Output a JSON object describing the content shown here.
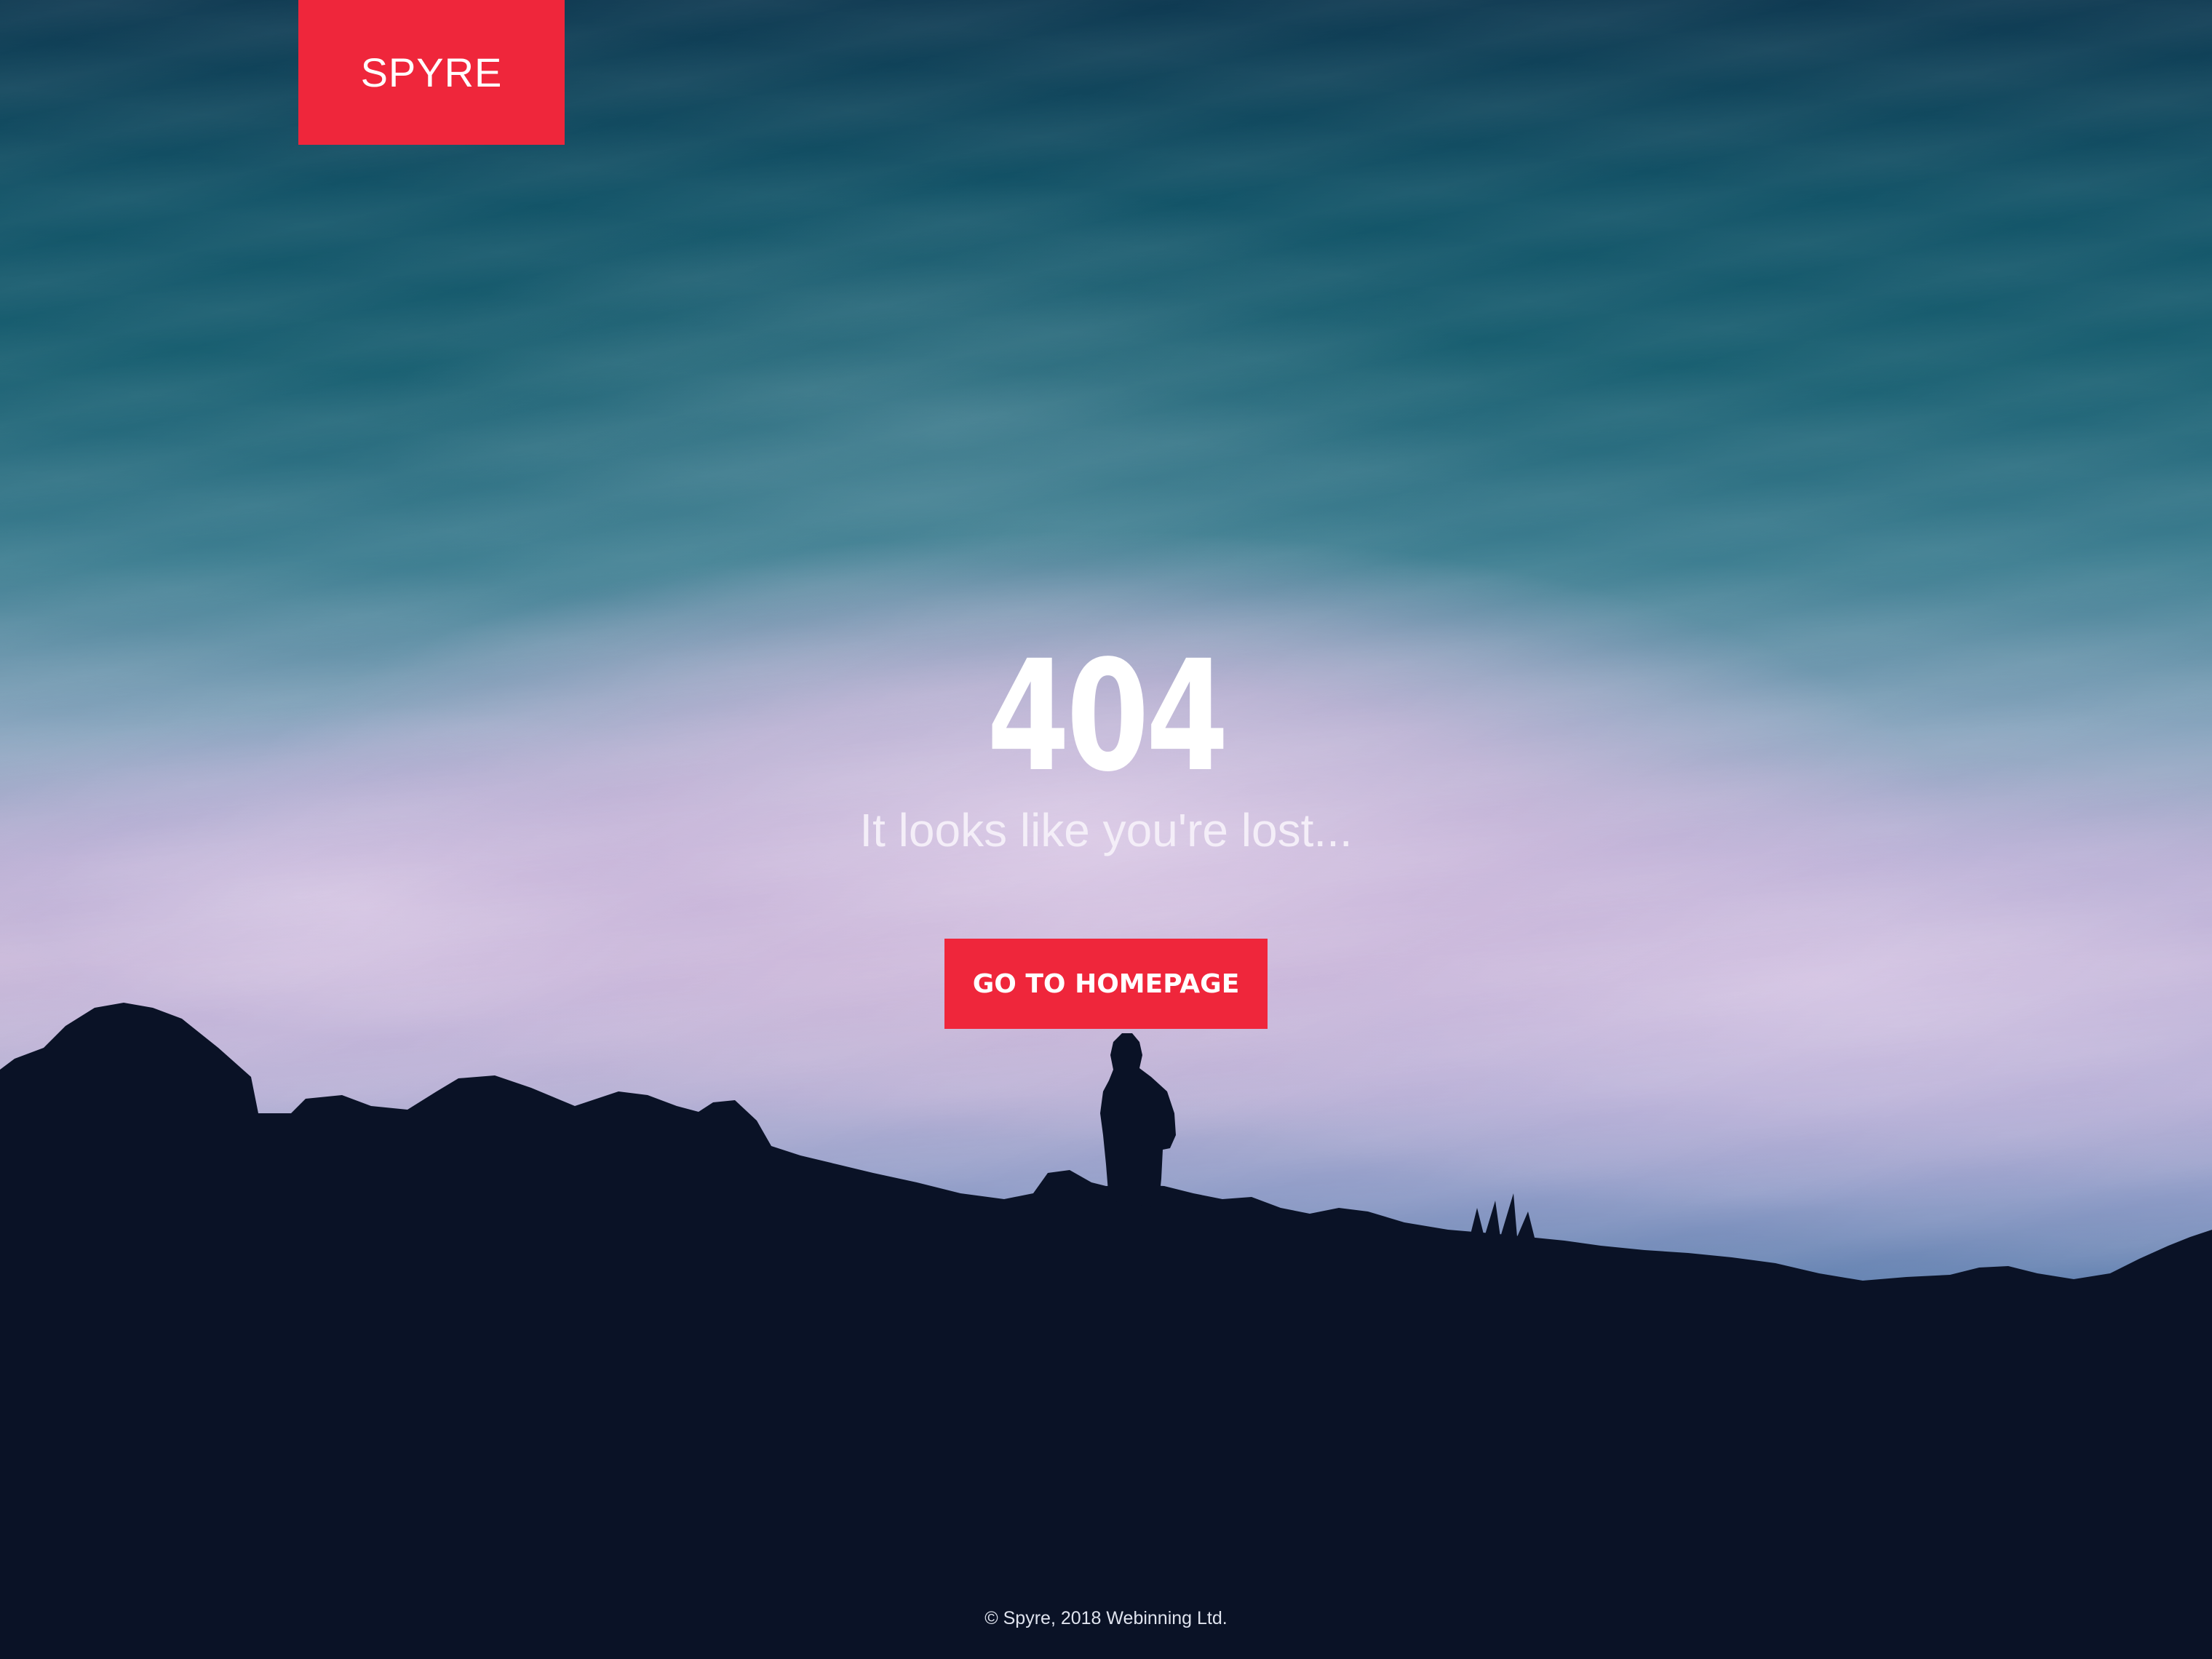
{
  "brand": {
    "logo_text": "SPYRE",
    "accent_color": "#ef263b"
  },
  "error": {
    "code": "404",
    "message": "It looks like you're lost..."
  },
  "actions": {
    "home_button_label": "GO TO HOMEPAGE"
  },
  "footer": {
    "copyright": "© Spyre, 2018 Webinning Ltd."
  }
}
